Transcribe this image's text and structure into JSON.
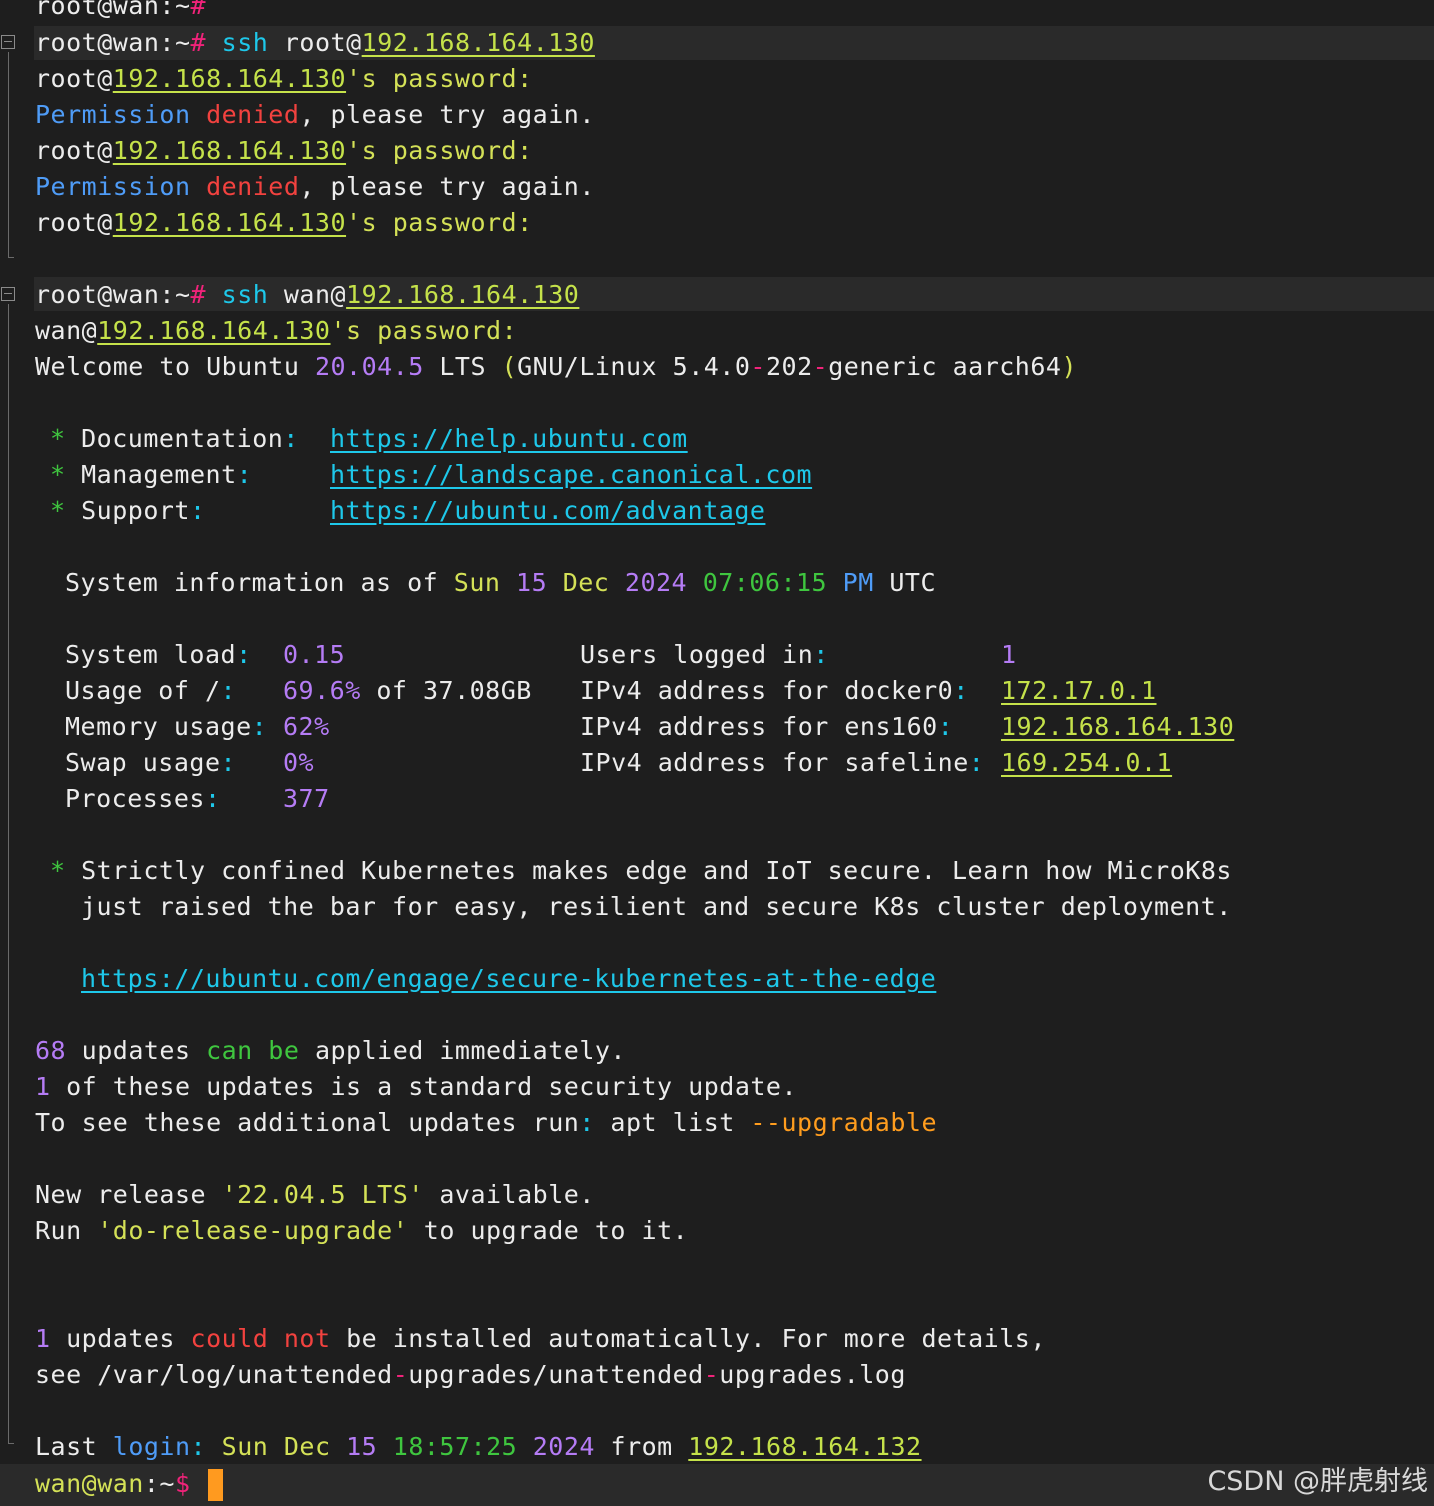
{
  "session": {
    "prompt_top_user": "root@wan",
    "prompt_top_sep": ":~",
    "prompt_top_hash": "#",
    "ssh_cmd": "ssh",
    "ssh1_user": "root@",
    "ssh1_host": "192.168.164.130",
    "pw1_user": "root@",
    "pw_host": "192.168.164.130",
    "pw_suffix": "'s password",
    "colon": ":",
    "perm_word": "Permission",
    "denied_word": "denied",
    "perm_rest": ", please try again.",
    "ssh2_user": "wan@",
    "ssh2_host": "192.168.164.130",
    "pw2_user": "wan@"
  },
  "motd": {
    "welcome_1": "Welcome to Ubuntu ",
    "welcome_ver": "20.04.5",
    "welcome_2": " LTS ",
    "welcome_paren_open": "(",
    "welcome_3": "GNU/Linux 5.4.0",
    "welcome_dash1": "-",
    "welcome_4": "202",
    "welcome_dash2": "-",
    "welcome_5": "generic aarch64",
    "welcome_paren_close": ")",
    "star": "*",
    "doc_label": "Documentation",
    "doc_url": "https://help.ubuntu.com",
    "mgmt_label": "Management",
    "mgmt_url": "https://landscape.canonical.com",
    "support_label": "Support",
    "support_url": "https://ubuntu.com/advantage",
    "sysinfo_1": "System information as of ",
    "sysinfo_day": "Sun",
    "sysinfo_date": "15",
    "sysinfo_mon": "Dec",
    "sysinfo_year": "2024",
    "sysinfo_time": "07:06:15",
    "sysinfo_pm": "PM",
    "sysinfo_tz": "UTC",
    "load_label": "System load",
    "load_val": "0.15",
    "usage_label": "Usage of /",
    "usage_val": "69.6%",
    "usage_of": " of 37.08GB",
    "mem_label": "Memory usage",
    "mem_val": "62%",
    "swap_label": "Swap usage",
    "swap_val": "0%",
    "proc_label": "Processes",
    "proc_val": "377",
    "users_label": "Users logged in",
    "users_val": "1",
    "docker_label": "IPv4 address for docker0",
    "docker_val": "172.17.0.1",
    "ens_label": "IPv4 address for ens160",
    "ens_val": "192.168.164.130",
    "safeline_label": "IPv4 address for safeline",
    "safeline_val": "169.254.0.1",
    "k8s_1": "Strictly confined Kubernetes makes edge and IoT secure. Learn how MicroK8s",
    "k8s_2": "just raised the bar for easy, resilient and secure K8s cluster deployment.",
    "k8s_url": "https://ubuntu.com/engage/secure-kubernetes-at-the-edge",
    "upd_count": "68",
    "upd_1": " updates ",
    "upd_can": "can",
    "upd_be": "be",
    "upd_2": " applied immediately.",
    "sec_count": "1",
    "sec_text": " of these updates is a standard security update.",
    "see_text": "To see these additional updates run",
    "see_cmd": " apt list ",
    "see_flag": "--upgradable",
    "rel_1": "New release ",
    "rel_ver": "'22.04.5 LTS'",
    "rel_2": " available.",
    "run_1": "Run ",
    "run_cmd": "'do-release-upgrade'",
    "run_2": " to upgrade to it.",
    "fail_count": "1",
    "fail_1": " updates ",
    "fail_could": "could",
    "fail_not": "not",
    "fail_2": " be installed automatically. For more details,",
    "log_1": "see /var/log/unattended",
    "log_dash1": "-",
    "log_2": "upgrades/unattended",
    "log_dash2": "-",
    "log_3": "upgrades.log",
    "last_1": "Last ",
    "last_login": "login",
    "last_day": "Sun",
    "last_mon": "Dec",
    "last_date": "15",
    "last_time": "18:57:25",
    "last_year": "2024",
    "last_from": " from ",
    "last_host": "192.168.164.132"
  },
  "prompt": {
    "user": "wan@wan",
    "sep": ":~",
    "dollar": "$"
  },
  "watermark": "CSDN @胖虎射线"
}
